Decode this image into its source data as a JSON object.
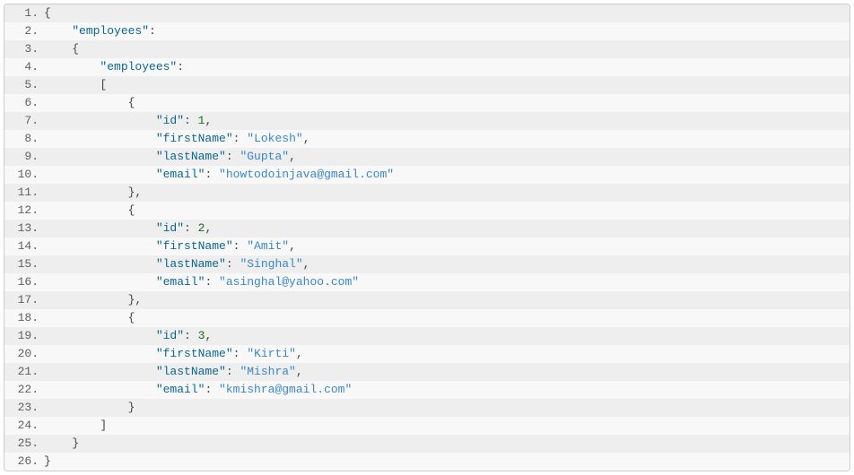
{
  "code": {
    "key_employees": "\"employees\"",
    "key_id": "\"id\"",
    "key_firstName": "\"firstName\"",
    "key_lastName": "\"lastName\"",
    "key_email": "\"email\"",
    "records": [
      {
        "id": "1",
        "firstName": "\"Lokesh\"",
        "lastName": "\"Gupta\"",
        "email": "\"howtodoinjava@gmail.com\""
      },
      {
        "id": "2",
        "firstName": "\"Amit\"",
        "lastName": "\"Singhal\"",
        "email": "\"asinghal@yahoo.com\""
      },
      {
        "id": "3",
        "firstName": "\"Kirti\"",
        "lastName": "\"Mishra\"",
        "email": "\"kmishra@gmail.com\""
      }
    ],
    "linenos": [
      "1.",
      "2.",
      "3.",
      "4.",
      "5.",
      "6.",
      "7.",
      "8.",
      "9.",
      "10.",
      "11.",
      "12.",
      "13.",
      "14.",
      "15.",
      "16.",
      "17.",
      "18.",
      "19.",
      "20.",
      "21.",
      "22.",
      "23.",
      "24.",
      "25.",
      "26."
    ]
  }
}
